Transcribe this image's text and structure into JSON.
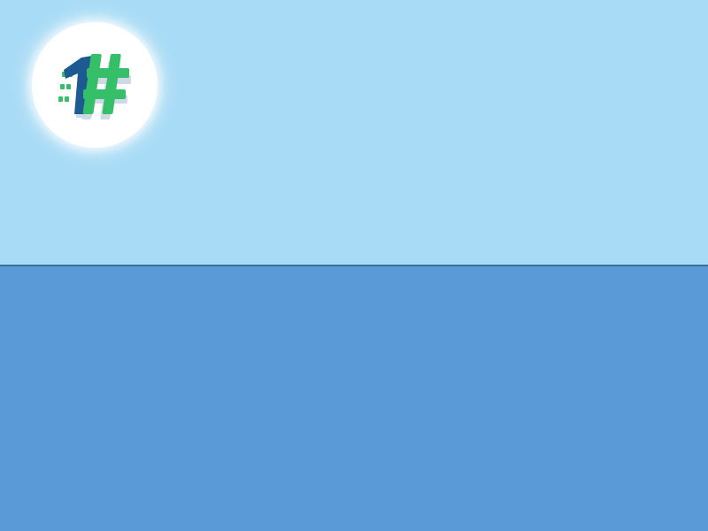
{
  "scene": {
    "colors": {
      "sky": "#a7dbf6",
      "horizon_line": "#3f6e96",
      "ground": "#5a9ad6"
    }
  },
  "logo": {
    "icon": "number-one-hashtag-logo-icon",
    "text": "1#",
    "colors": {
      "one": "#1c5a91",
      "hash": "#34bf68",
      "shadow": "#cfd8e6",
      "badge": "#ffffff"
    }
  }
}
